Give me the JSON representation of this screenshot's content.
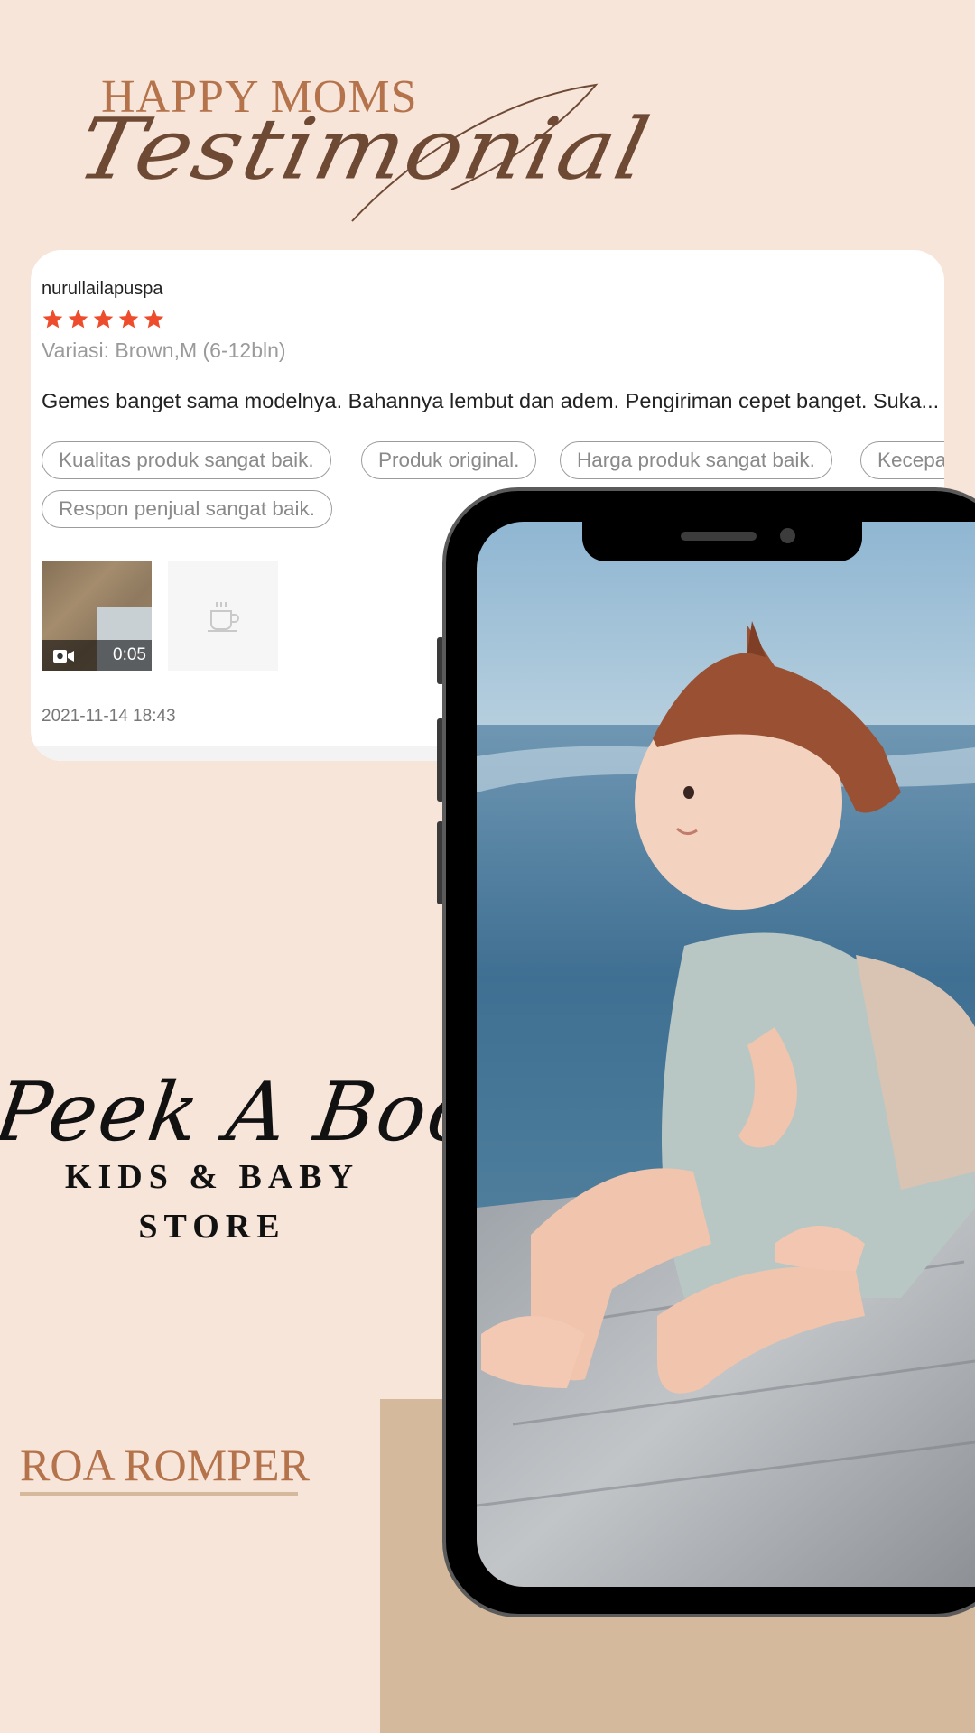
{
  "header": {
    "kicker": "HAPPY MOMS",
    "title": "Testimonial"
  },
  "review": {
    "username": "nurullailapuspa",
    "rating": 5,
    "variation": "Variasi: Brown,M (6-12bln)",
    "comment": "Gemes banget sama modelnya. Bahannya lembut dan adem. Pengiriman cepet banget. Suka...",
    "tags": [
      "Kualitas produk sangat baik.",
      "Produk original.",
      "Harga produk sangat baik.",
      "Kecepa",
      "Respon penjual sangat baik."
    ],
    "video_duration": "0:05",
    "date": "2021-11-14 18:43"
  },
  "brand": {
    "script": "Peek A Boo",
    "line1": "KIDS & BABY",
    "line2": "STORE"
  },
  "product": {
    "name": "ROA ROMPER"
  },
  "colors": {
    "background": "#f7e5da",
    "accent": "#b5734c",
    "star": "#ee4d2d",
    "block": "#d4b99d"
  },
  "icons": [
    "star-icon",
    "video-camera-icon",
    "image-placeholder-icon"
  ]
}
